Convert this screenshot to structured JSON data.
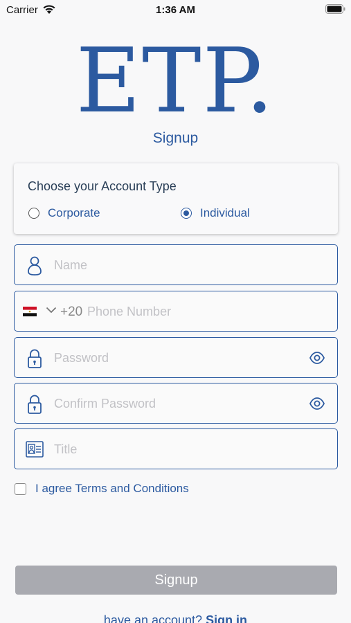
{
  "status_bar": {
    "carrier": "Carrier",
    "time": "1:36 AM"
  },
  "logo": {
    "text": "ETP",
    "dot": "."
  },
  "page_title": "Signup",
  "account_type": {
    "title": "Choose your Account Type",
    "options": [
      {
        "label": "Corporate",
        "selected": false
      },
      {
        "label": "Individual",
        "selected": true
      }
    ]
  },
  "fields": {
    "name": {
      "placeholder": "Name",
      "value": ""
    },
    "phone": {
      "dial_code": "+20",
      "placeholder": "Phone Number",
      "value": ""
    },
    "password": {
      "placeholder": "Password",
      "value": ""
    },
    "confirm_password": {
      "placeholder": "Confirm Password",
      "value": ""
    },
    "title": {
      "placeholder": "Title",
      "value": ""
    }
  },
  "agree": {
    "label": "I agree Terms and Conditions",
    "checked": false
  },
  "signup_button": "Signup",
  "signin": {
    "prompt": "have an account?",
    "link": "Sign in"
  },
  "colors": {
    "accent": "#2c5aa0",
    "button_disabled": "#a9aab0",
    "background": "#f8f8f9"
  },
  "icons": [
    "wifi-icon",
    "battery-icon",
    "user-icon",
    "egypt-flag-icon",
    "chevron-down-icon",
    "lock-icon",
    "eye-icon",
    "id-card-icon"
  ]
}
